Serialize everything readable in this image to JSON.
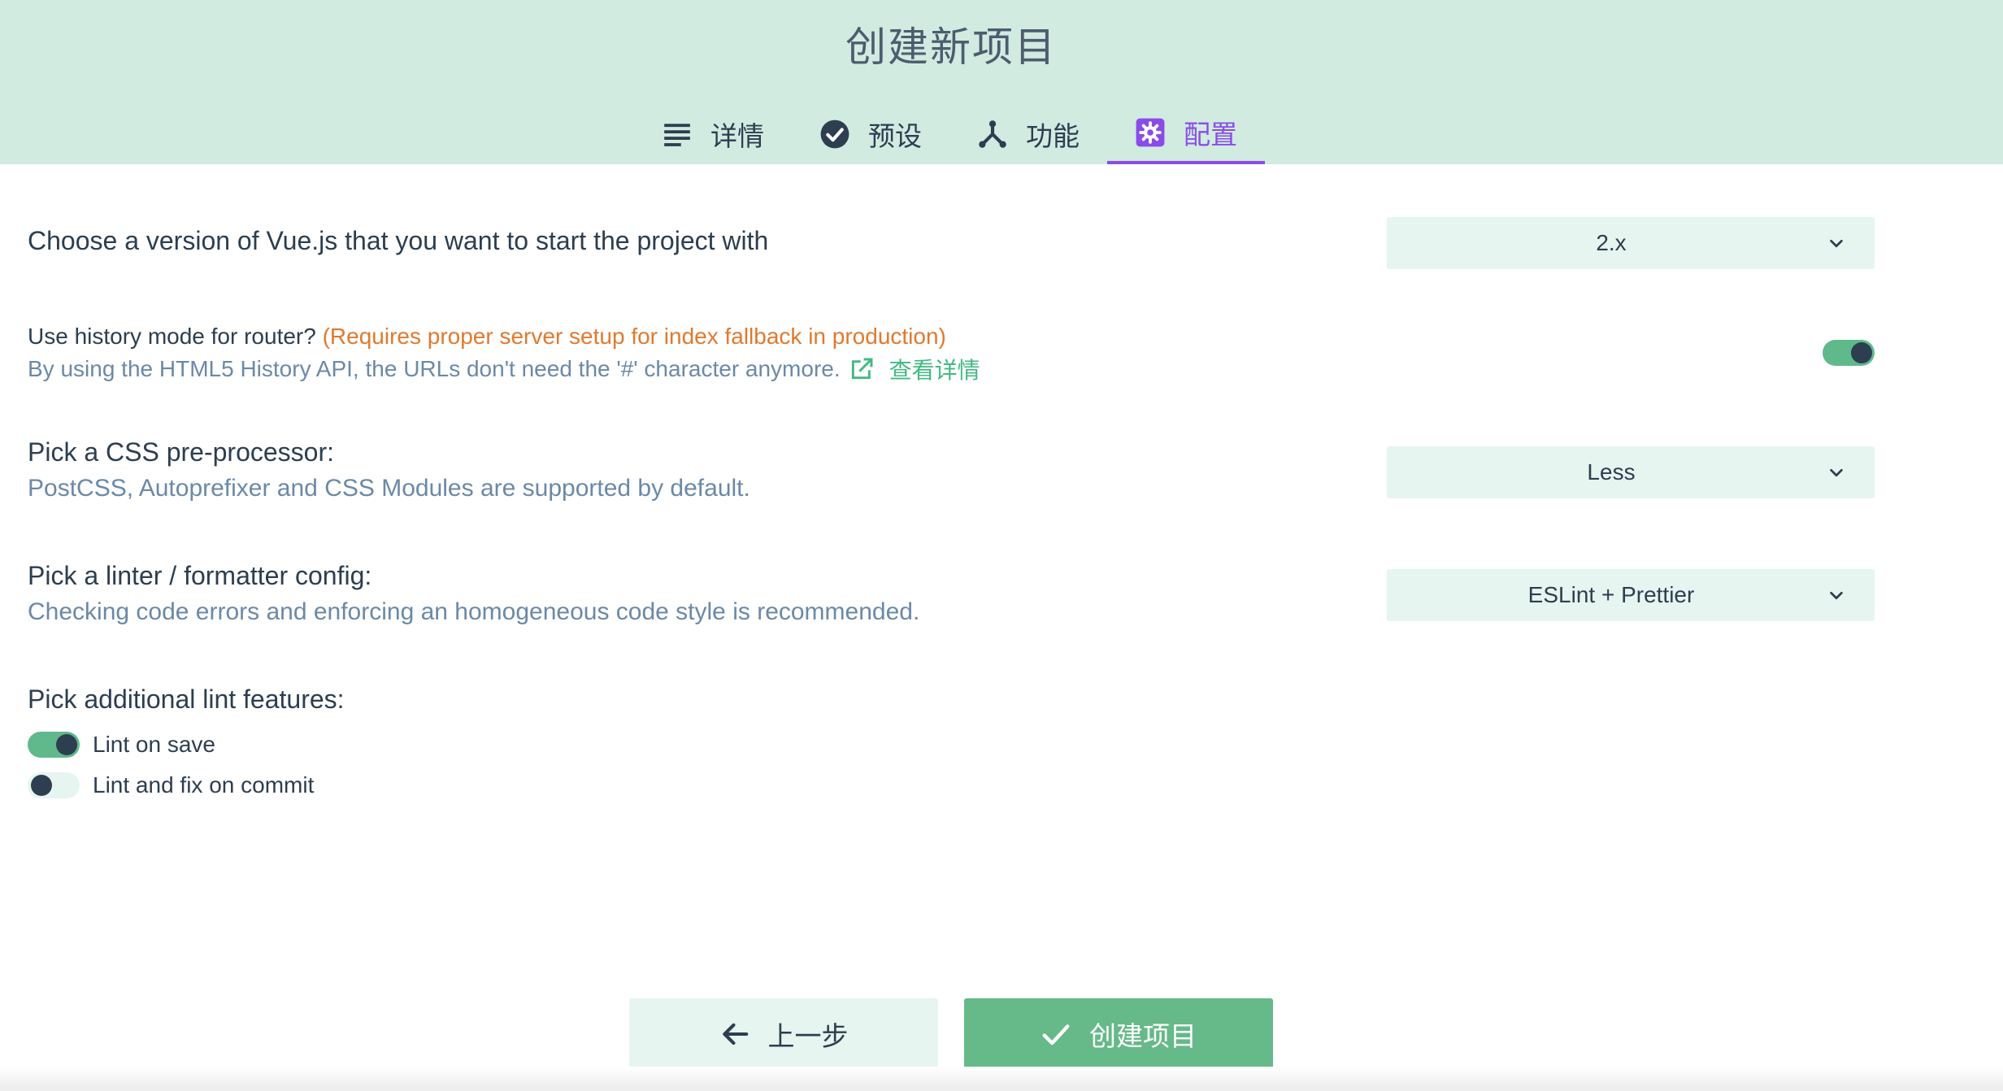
{
  "title": "创建新项目",
  "tabs": [
    {
      "label": "详情",
      "icon": "list-icon"
    },
    {
      "label": "预设",
      "icon": "check-circle-icon"
    },
    {
      "label": "功能",
      "icon": "fork-icon"
    },
    {
      "label": "配置",
      "icon": "gear-icon",
      "active": true
    }
  ],
  "vue_version": {
    "label": "Choose a version of Vue.js that you want to start the project with",
    "value": "2.x"
  },
  "history_mode": {
    "label": "Use history mode for router?",
    "warning": "(Requires proper server setup for index fallback in production)",
    "description": "By using the HTML5 History API, the URLs don't need the '#' character anymore.",
    "link_label": "查看详情",
    "enabled": true
  },
  "css_preprocessor": {
    "label": "Pick a CSS pre-processor:",
    "description": "PostCSS, Autoprefixer and CSS Modules are supported by default.",
    "value": "Less"
  },
  "linter": {
    "label": "Pick a linter / formatter config:",
    "description": "Checking code errors and enforcing an homogeneous code style is recommended.",
    "value": "ESLint + Prettier"
  },
  "lint_features": {
    "label": "Pick additional lint features:",
    "options": [
      {
        "label": "Lint on save",
        "enabled": true
      },
      {
        "label": "Lint and fix on commit",
        "enabled": false
      }
    ]
  },
  "buttons": {
    "prev": "上一步",
    "create": "创建项目"
  },
  "colors": {
    "accent": "#8a4ce8",
    "primary": "#42b983",
    "header_bg": "#d1ebe1"
  }
}
